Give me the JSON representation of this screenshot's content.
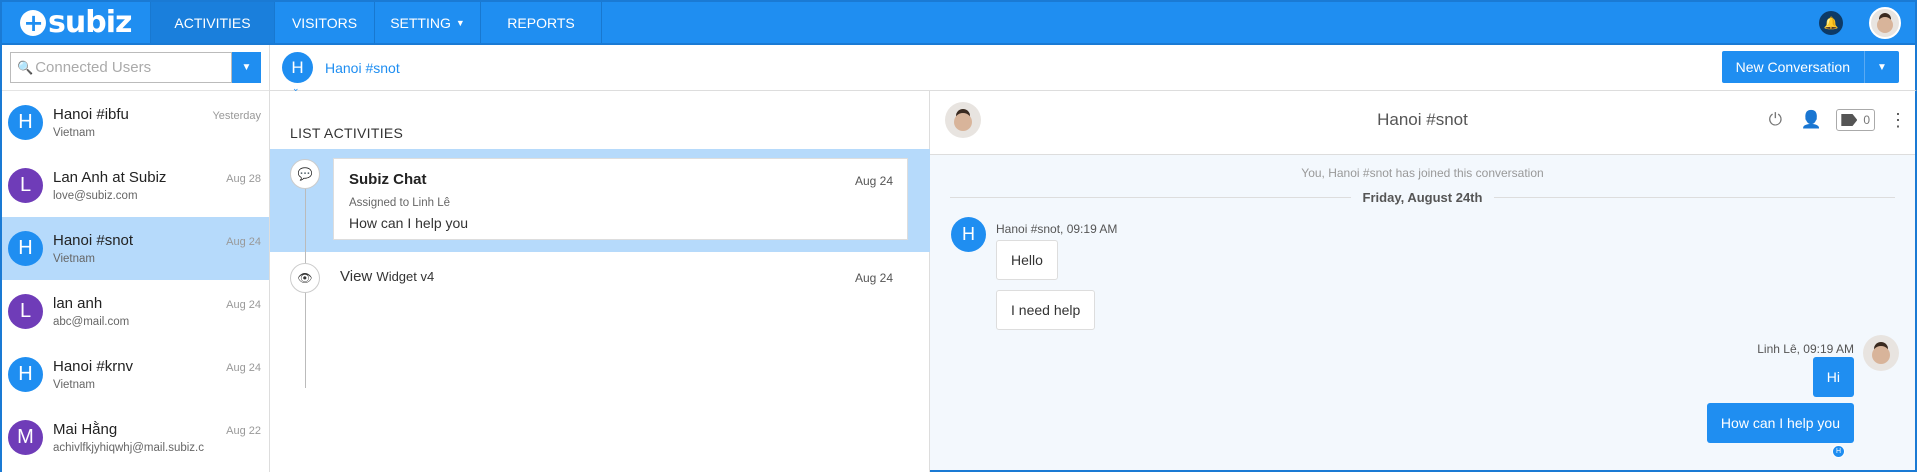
{
  "nav": {
    "logo": "subiz",
    "tabs": [
      {
        "label": "ACTIVITIES"
      },
      {
        "label": "VISITORS"
      },
      {
        "label": "SETTING"
      },
      {
        "label": "REPORTS"
      }
    ]
  },
  "search": {
    "placeholder": "Connected Users"
  },
  "contacts": [
    {
      "initial": "H",
      "name": "Hanoi #ibfu",
      "sub": "Vietnam",
      "date": "Yesterday",
      "color": "#1f8ef1"
    },
    {
      "initial": "L",
      "name": "Lan Anh at Subiz",
      "sub": "love@subiz.com",
      "date": "Aug 28",
      "color": "#6f3cb8"
    },
    {
      "initial": "H",
      "name": "Hanoi #snot",
      "sub": "Vietnam",
      "date": "Aug 24",
      "color": "#1f8ef1"
    },
    {
      "initial": "L",
      "name": "lan anh",
      "sub": "abc@mail.com",
      "date": "Aug 24",
      "color": "#6f3cb8"
    },
    {
      "initial": "H",
      "name": "Hanoi #krnv",
      "sub": "Vietnam",
      "date": "Aug 24",
      "color": "#1f8ef1"
    },
    {
      "initial": "M",
      "name": "Mai Hằng",
      "sub": "achivlfkjyhiqwhj@mail.subiz.c",
      "date": "Aug 22",
      "color": "#6f3cb8"
    }
  ],
  "subheader": {
    "initial": "H",
    "title": "Hanoi #snot",
    "new_conversation": "New Conversation"
  },
  "activities": {
    "title": "LIST ACTIVITIES",
    "card": {
      "title": "Subiz Chat",
      "date": "Aug 24",
      "assigned": "Assigned to Linh Lê",
      "message": "How can I help you"
    },
    "view": {
      "label": "View",
      "detail": "Widget v4",
      "date": "Aug 24"
    }
  },
  "chat": {
    "title": "Hanoi #snot",
    "tag_count": "0",
    "system_message": "You, Hanoi #snot has joined this conversation",
    "day": "Friday, August 24th",
    "visitor_initial": "H",
    "visitor_meta": "Hanoi #snot, 09:19 AM",
    "visitor_messages": [
      "Hello",
      "I need help"
    ],
    "agent_meta": "Linh Lê, 09:19 AM",
    "agent_messages": [
      "Hi",
      "How can I help you"
    ],
    "seen_initial": "H"
  }
}
